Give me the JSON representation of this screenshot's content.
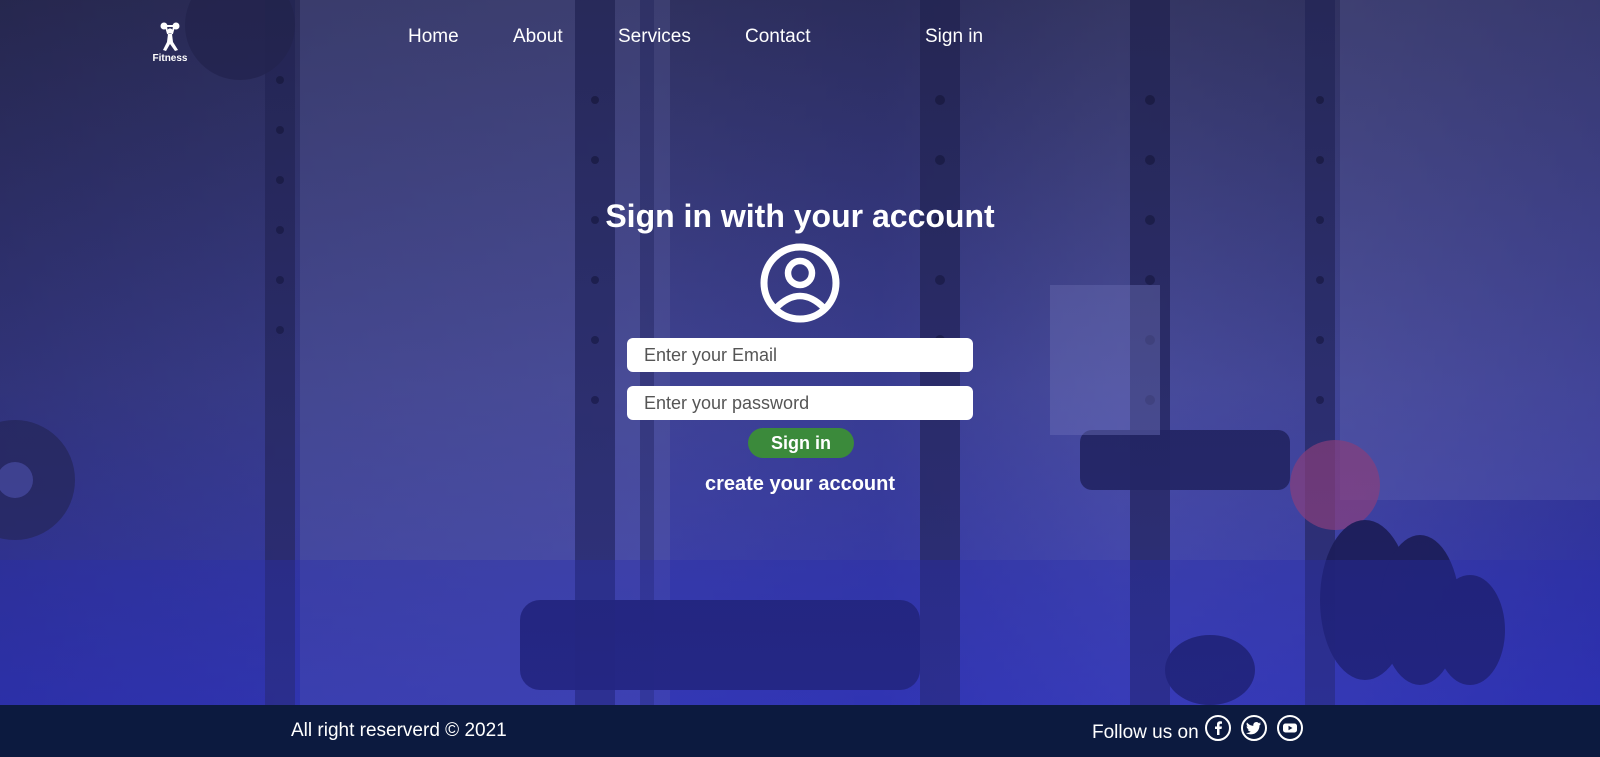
{
  "brand": {
    "logo_text": "Fitness"
  },
  "nav": {
    "items": [
      {
        "label": "Home"
      },
      {
        "label": "About"
      },
      {
        "label": "Services"
      },
      {
        "label": "Contact"
      }
    ],
    "signin_label": "Sign in"
  },
  "signin": {
    "heading": "Sign in with your account",
    "email_placeholder": "Enter your Email",
    "password_placeholder": "Enter your password",
    "button_label": "Sign in",
    "create_account_label": "create your account"
  },
  "footer": {
    "copyright": "All right reserverd © 2021",
    "follow_label": "Follow us on",
    "social": [
      "facebook-icon",
      "twitter-icon",
      "youtube-icon"
    ]
  },
  "colors": {
    "accent_green": "#3b8a3b",
    "footer_bg": "#0c1a3f"
  }
}
